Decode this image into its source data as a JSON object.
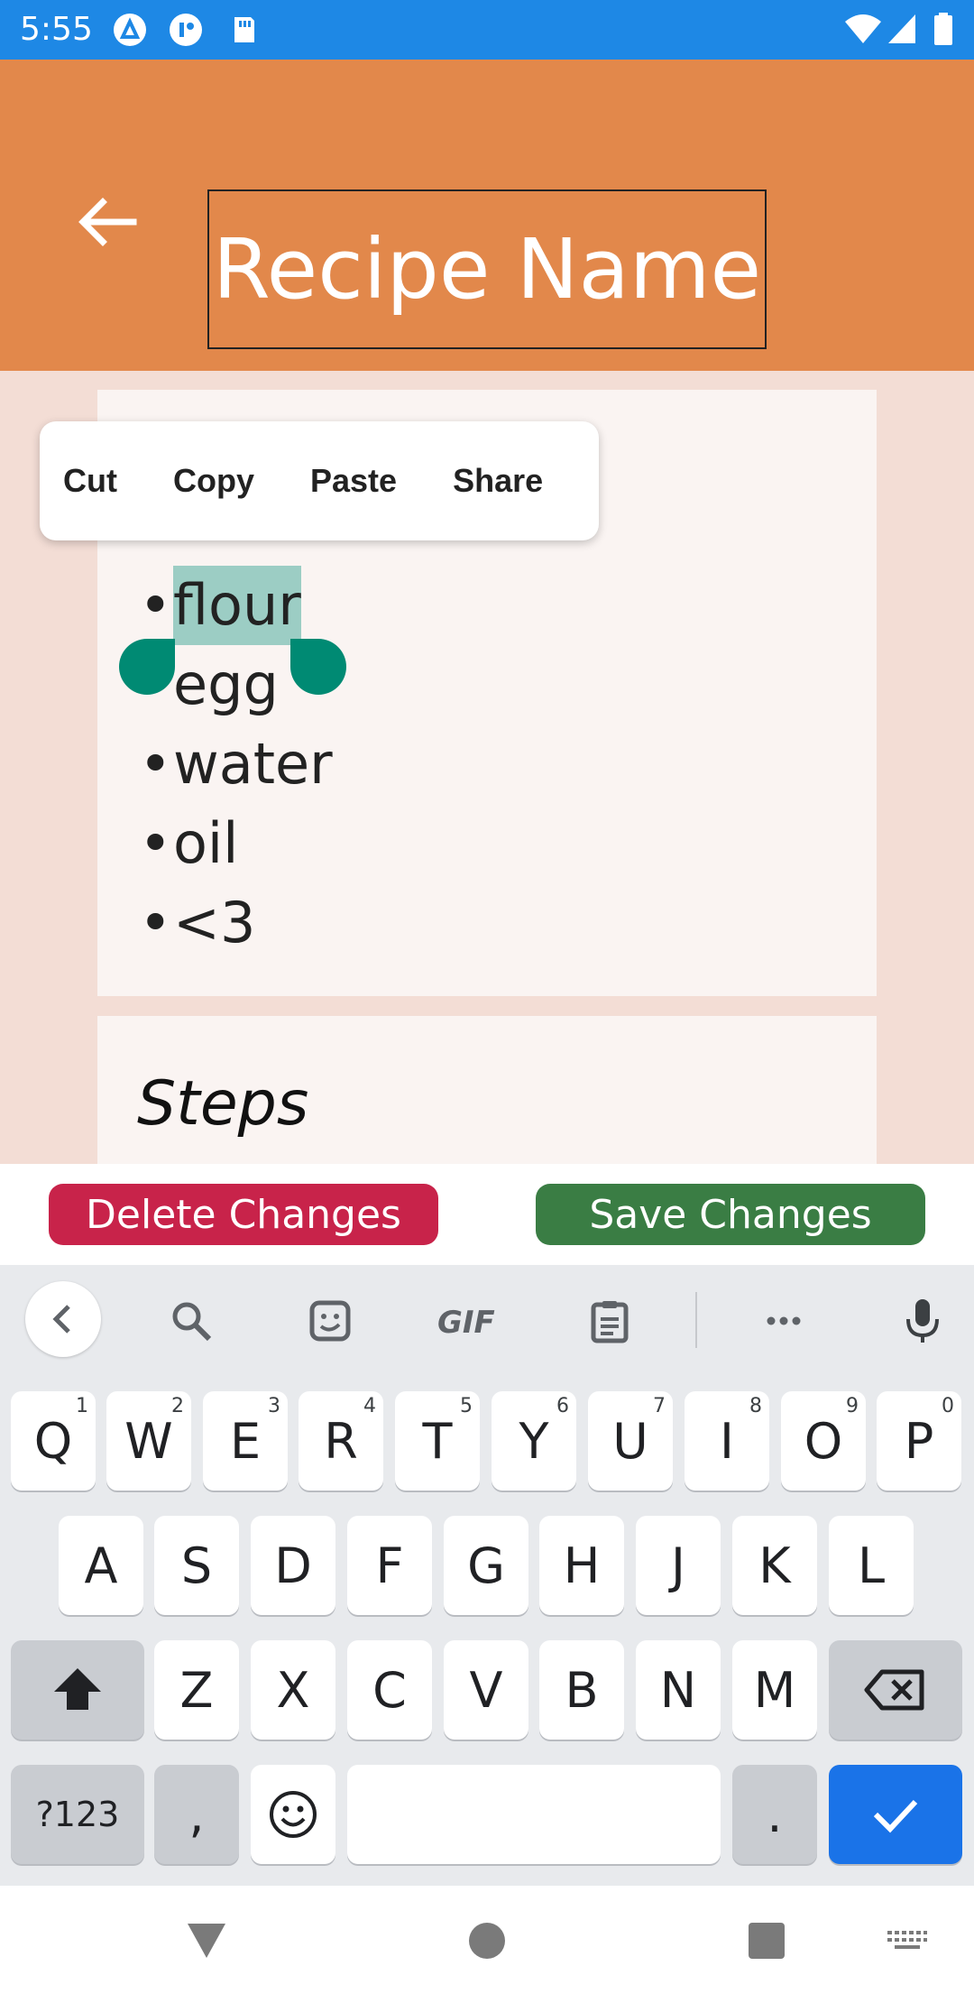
{
  "status_bar": {
    "time": "5:55"
  },
  "header": {
    "title": "Recipe Name"
  },
  "context_menu": {
    "items": [
      "Cut",
      "Copy",
      "Paste",
      "Share"
    ]
  },
  "ingredients": {
    "items": [
      {
        "bullet": "•",
        "text": "flour"
      },
      {
        "bullet": "",
        "text": "egg"
      },
      {
        "bullet": "•",
        "text": "water"
      },
      {
        "bullet": "•",
        "text": "oil"
      },
      {
        "bullet": "•",
        "text": "<3"
      }
    ]
  },
  "steps": {
    "title": "Steps"
  },
  "actions": {
    "delete_label": "Delete Changes",
    "save_label": "Save Changes"
  },
  "keyboard": {
    "toolbar": {
      "gif_label": "GIF"
    },
    "row1": [
      {
        "key": "Q",
        "hint": "1"
      },
      {
        "key": "W",
        "hint": "2"
      },
      {
        "key": "E",
        "hint": "3"
      },
      {
        "key": "R",
        "hint": "4"
      },
      {
        "key": "T",
        "hint": "5"
      },
      {
        "key": "Y",
        "hint": "6"
      },
      {
        "key": "U",
        "hint": "7"
      },
      {
        "key": "I",
        "hint": "8"
      },
      {
        "key": "O",
        "hint": "9"
      },
      {
        "key": "P",
        "hint": "0"
      }
    ],
    "row2": [
      "A",
      "S",
      "D",
      "F",
      "G",
      "H",
      "J",
      "K",
      "L"
    ],
    "row3": [
      "Z",
      "X",
      "C",
      "V",
      "B",
      "N",
      "M"
    ],
    "symbols_label": "?123",
    "comma_label": ",",
    "period_label": "."
  },
  "colors": {
    "status_bar": "#1e88e5",
    "header": "#e2884b",
    "delete": "#c8234a",
    "save": "#3a7d44",
    "selection": "#9ccdc4",
    "handle": "#008a73",
    "enter_key": "#1a73e8"
  }
}
